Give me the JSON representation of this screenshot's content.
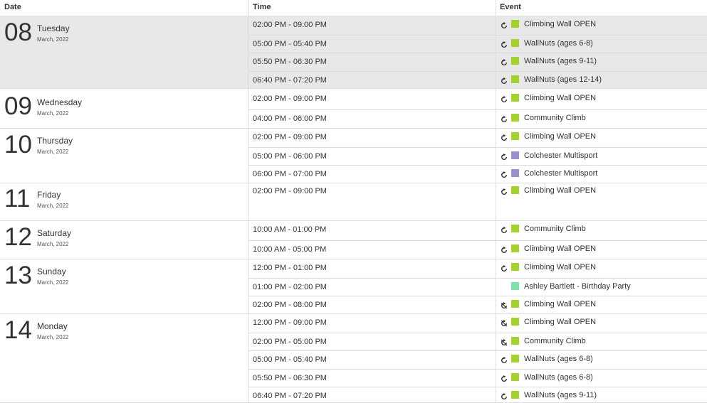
{
  "columns": {
    "date": "Date",
    "time": "Time",
    "event": "Event"
  },
  "colors": {
    "climbing": "#a3d12d",
    "multisport": "#9b8fcc",
    "party": "#7fe0a8"
  },
  "days": [
    {
      "num": "08",
      "weekday": "Tuesday",
      "month": "March, 2022",
      "shaded": true,
      "events": [
        {
          "time": "02:00 PM - 09:00 PM",
          "title": "Climbing Wall OPEN",
          "color": "#a3d12d",
          "icon": "recurring-icon"
        },
        {
          "time": "05:00 PM - 05:40 PM",
          "title": "WallNuts (ages 6-8)",
          "color": "#a3d12d",
          "icon": "recurring-icon"
        },
        {
          "time": "05:50 PM - 06:30 PM",
          "title": "WallNuts (ages 9-11)",
          "color": "#a3d12d",
          "icon": "recurring-icon"
        },
        {
          "time": "06:40 PM - 07:20 PM",
          "title": "WallNuts (ages 12-14)",
          "color": "#a3d12d",
          "icon": "recurring-icon"
        }
      ]
    },
    {
      "num": "09",
      "weekday": "Wednesday",
      "month": "March, 2022",
      "shaded": false,
      "events": [
        {
          "time": "02:00 PM - 09:00 PM",
          "title": "Climbing Wall OPEN",
          "color": "#a3d12d",
          "icon": "recurring-icon"
        },
        {
          "time": "04:00 PM - 06:00 PM",
          "title": "Community Climb",
          "color": "#a3d12d",
          "icon": "recurring-icon"
        }
      ]
    },
    {
      "num": "10",
      "weekday": "Thursday",
      "month": "March, 2022",
      "shaded": false,
      "events": [
        {
          "time": "02:00 PM - 09:00 PM",
          "title": "Climbing Wall OPEN",
          "color": "#a3d12d",
          "icon": "recurring-icon"
        },
        {
          "time": "05:00 PM - 06:00 PM",
          "title": "Colchester Multisport",
          "color": "#9b8fcc",
          "icon": "recurring-icon"
        },
        {
          "time": "06:00 PM - 07:00 PM",
          "title": "Colchester Multisport",
          "color": "#9b8fcc",
          "icon": "recurring-icon"
        }
      ]
    },
    {
      "num": "11",
      "weekday": "Friday",
      "month": "March, 2022",
      "shaded": false,
      "events": [
        {
          "time": "02:00 PM - 09:00 PM",
          "title": "Climbing Wall OPEN",
          "color": "#a3d12d",
          "icon": "recurring-icon"
        }
      ]
    },
    {
      "num": "12",
      "weekday": "Saturday",
      "month": "March, 2022",
      "shaded": false,
      "events": [
        {
          "time": "10:00 AM - 01:00 PM",
          "title": "Community Climb",
          "color": "#a3d12d",
          "icon": "recurring-icon"
        },
        {
          "time": "10:00 AM - 05:00 PM",
          "title": "Climbing Wall OPEN",
          "color": "#a3d12d",
          "icon": "recurring-icon"
        }
      ]
    },
    {
      "num": "13",
      "weekday": "Sunday",
      "month": "March, 2022",
      "shaded": false,
      "events": [
        {
          "time": "12:00 PM - 01:00 PM",
          "title": "Climbing Wall OPEN",
          "color": "#a3d12d",
          "icon": "recurring-icon"
        },
        {
          "time": "01:00 PM - 02:00 PM",
          "title": "Ashley Bartlett - Birthday Party",
          "color": "#7fe0a8",
          "icon": ""
        },
        {
          "time": "02:00 PM - 08:00 PM",
          "title": "Climbing Wall OPEN",
          "color": "#a3d12d",
          "icon": "recurring-exception-icon"
        }
      ]
    },
    {
      "num": "14",
      "weekday": "Monday",
      "month": "March, 2022",
      "shaded": false,
      "events": [
        {
          "time": "12:00 PM - 09:00 PM",
          "title": "Climbing Wall OPEN",
          "color": "#a3d12d",
          "icon": "recurring-exception-icon"
        },
        {
          "time": "02:00 PM - 05:00 PM",
          "title": "Community Climb",
          "color": "#a3d12d",
          "icon": "recurring-exception-icon"
        },
        {
          "time": "05:00 PM - 05:40 PM",
          "title": "WallNuts (ages 6-8)",
          "color": "#a3d12d",
          "icon": "recurring-icon"
        },
        {
          "time": "05:50 PM - 06:30 PM",
          "title": "WallNuts (ages 6-8)",
          "color": "#a3d12d",
          "icon": "recurring-icon"
        },
        {
          "time": "06:40 PM - 07:20 PM",
          "title": "WallNuts (ages 9-11)",
          "color": "#a3d12d",
          "icon": "recurring-icon"
        }
      ]
    }
  ]
}
